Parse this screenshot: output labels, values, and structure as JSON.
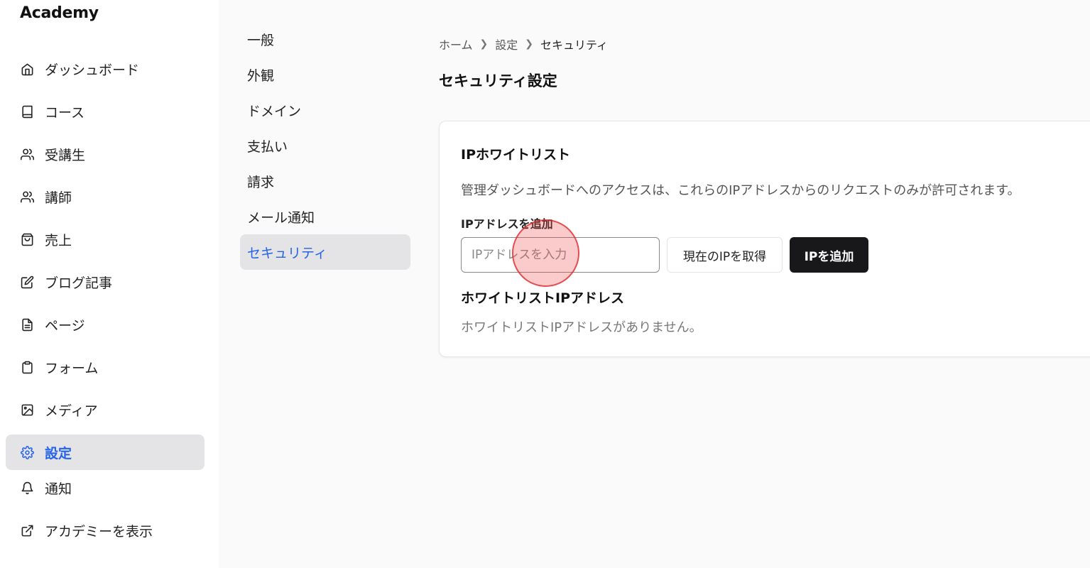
{
  "app": {
    "brand": "Academy"
  },
  "sidebar": {
    "items": [
      {
        "label": "ダッシュボード",
        "icon": "home-icon"
      },
      {
        "label": "コース",
        "icon": "book-icon"
      },
      {
        "label": "受講生",
        "icon": "users-icon"
      },
      {
        "label": "講師",
        "icon": "users-icon"
      },
      {
        "label": "売上",
        "icon": "shopping-bag-icon"
      },
      {
        "label": "ブログ記事",
        "icon": "edit-icon"
      },
      {
        "label": "ページ",
        "icon": "file-text-icon"
      },
      {
        "label": "フォーム",
        "icon": "clipboard-icon"
      },
      {
        "label": "メディア",
        "icon": "image-icon"
      },
      {
        "label": "設定",
        "icon": "gear-icon",
        "active": true
      },
      {
        "label": "通知",
        "icon": "bell-icon"
      },
      {
        "label": "アカデミーを表示",
        "icon": "external-link-icon"
      }
    ]
  },
  "settings_nav": {
    "items": [
      {
        "label": "一般"
      },
      {
        "label": "外観"
      },
      {
        "label": "ドメイン"
      },
      {
        "label": "支払い"
      },
      {
        "label": "請求"
      },
      {
        "label": "メール通知"
      },
      {
        "label": "セキュリティ",
        "active": true
      }
    ]
  },
  "breadcrumb": [
    "ホーム",
    "設定",
    "セキュリティ"
  ],
  "page": {
    "title": "セキュリティ設定"
  },
  "ip_whitelist": {
    "title": "IPホワイトリスト",
    "description": "管理ダッシュボードへのアクセスは、これらのIPアドレスからのリクエストのみが許可されます。",
    "field_label": "IPアドレスを追加",
    "input_placeholder": "IPアドレスを入力",
    "input_value": "",
    "get_current_ip_label": "現在のIPを取得",
    "add_ip_label": "IPを追加",
    "list_title": "ホワイトリストIPアドレス",
    "empty_message": "ホワイトリストIPアドレスがありません。"
  },
  "colors": {
    "accent": "#2563eb",
    "primary_button": "#18181b",
    "active_bg": "#e4e4e7",
    "click_marker": "#ef4444"
  }
}
